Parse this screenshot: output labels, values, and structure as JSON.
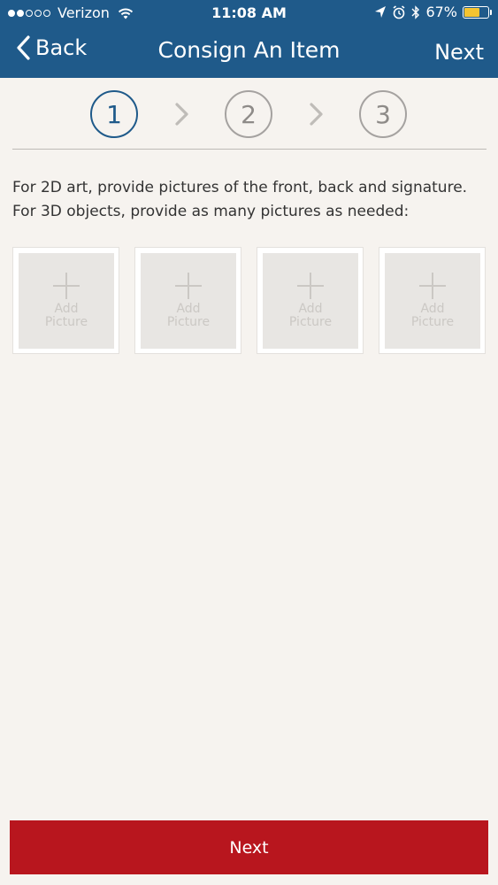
{
  "status_bar": {
    "carrier": "Verizon",
    "time": "11:08 AM",
    "battery": "67%",
    "battery_level": 0.67,
    "signal_dots_filled": 2,
    "signal_dots_total": 5
  },
  "nav": {
    "back_label": "Back",
    "title": "Consign An Item",
    "next_label": "Next"
  },
  "steps": [
    {
      "label": "1",
      "active": true
    },
    {
      "label": "2",
      "active": false
    },
    {
      "label": "3",
      "active": false
    }
  ],
  "instructions": {
    "line1": "For 2D art, provide pictures of the front, back and signature.",
    "line2": "For 3D objects, provide as many pictures as needed:"
  },
  "tiles": [
    {
      "line1": "Add",
      "line2": "Picture"
    },
    {
      "line1": "Add",
      "line2": "Picture"
    },
    {
      "line1": "Add",
      "line2": "Picture"
    },
    {
      "line1": "Add",
      "line2": "Picture"
    }
  ],
  "footer": {
    "next_label": "Next"
  },
  "colors": {
    "header": "#1f5a8a",
    "accent_red": "#b8161e",
    "background": "#f6f3ef"
  }
}
